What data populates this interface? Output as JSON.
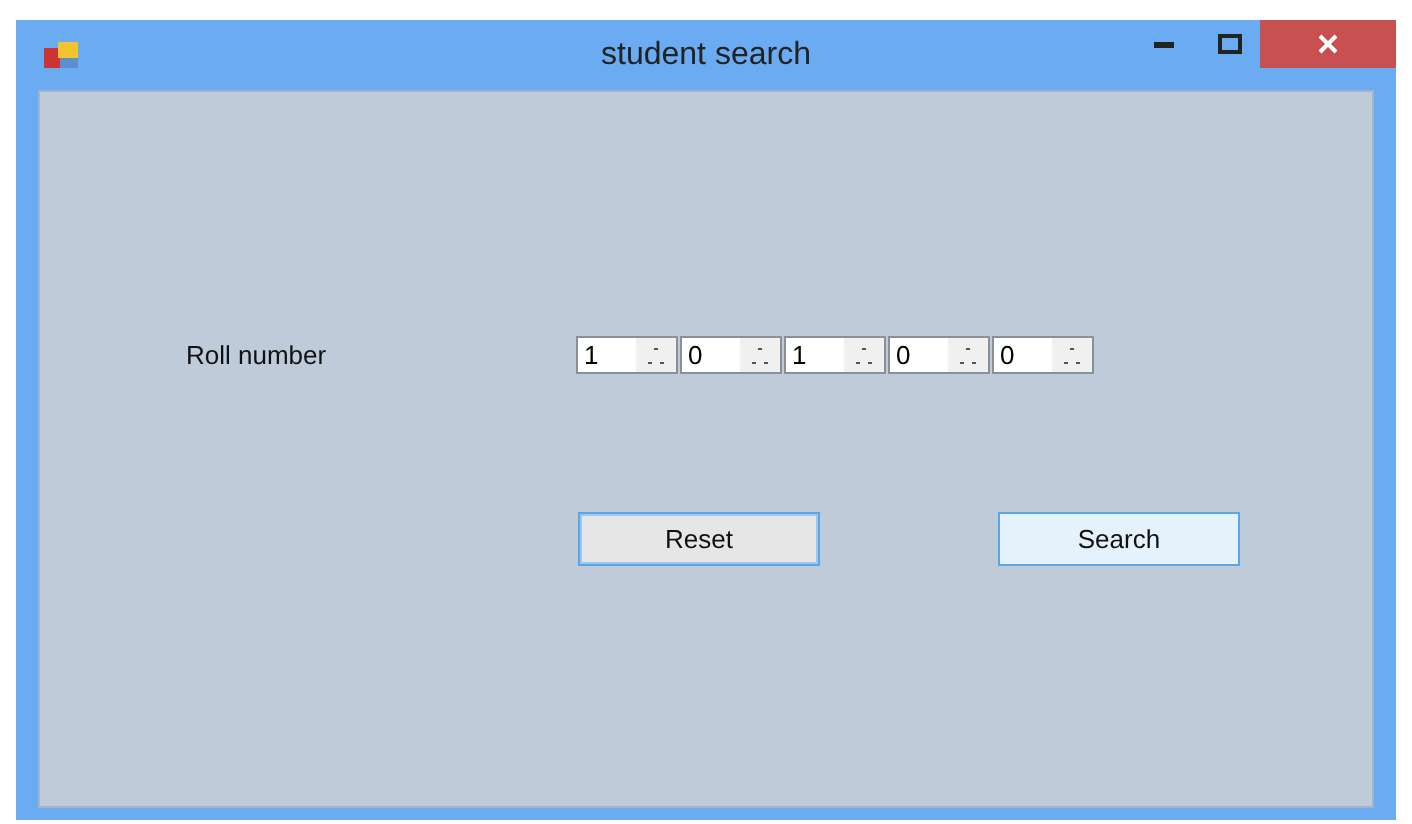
{
  "window": {
    "title": "student search"
  },
  "roll": {
    "label": "Roll number",
    "digits": [
      {
        "value": "1"
      },
      {
        "value": "0"
      },
      {
        "value": "1"
      },
      {
        "value": "0"
      },
      {
        "value": "0"
      }
    ]
  },
  "buttons": [
    {
      "label": "Reset",
      "focused": true,
      "hovered": false
    },
    {
      "label": "Search",
      "focused": false,
      "hovered": true
    }
  ]
}
